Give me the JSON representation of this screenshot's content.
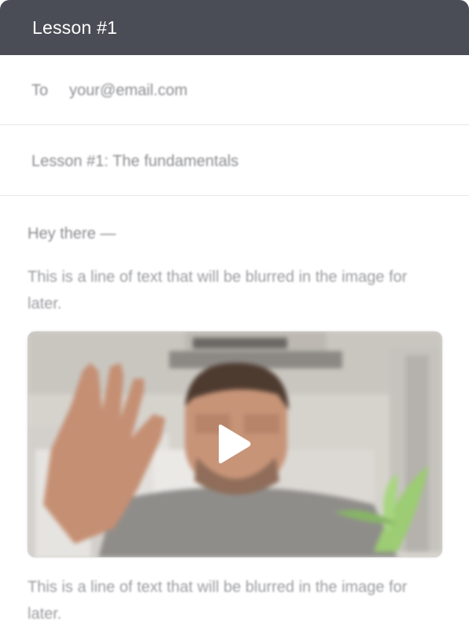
{
  "window": {
    "title": "Lesson #1"
  },
  "email": {
    "to_label": "To",
    "to_value": "your@email.com",
    "subject": "Lesson #1: The fundamentals",
    "greeting": "Hey there —",
    "paragraph_1": "This is a line of text that will be blurred in the image for later.",
    "paragraph_2": "This is a line of text that will be blurred in the image for later."
  },
  "video": {
    "play_icon": "play-icon",
    "colors": {
      "background": "#d9d7d2",
      "shirt": "#8f8d8a",
      "skin": "#c79478",
      "hair": "#4e3b30",
      "plant": "#9ccc73"
    }
  },
  "colors": {
    "titlebar": "#4a4d55",
    "divider": "#e6e6e8",
    "muted_text": "#8b8c90"
  }
}
